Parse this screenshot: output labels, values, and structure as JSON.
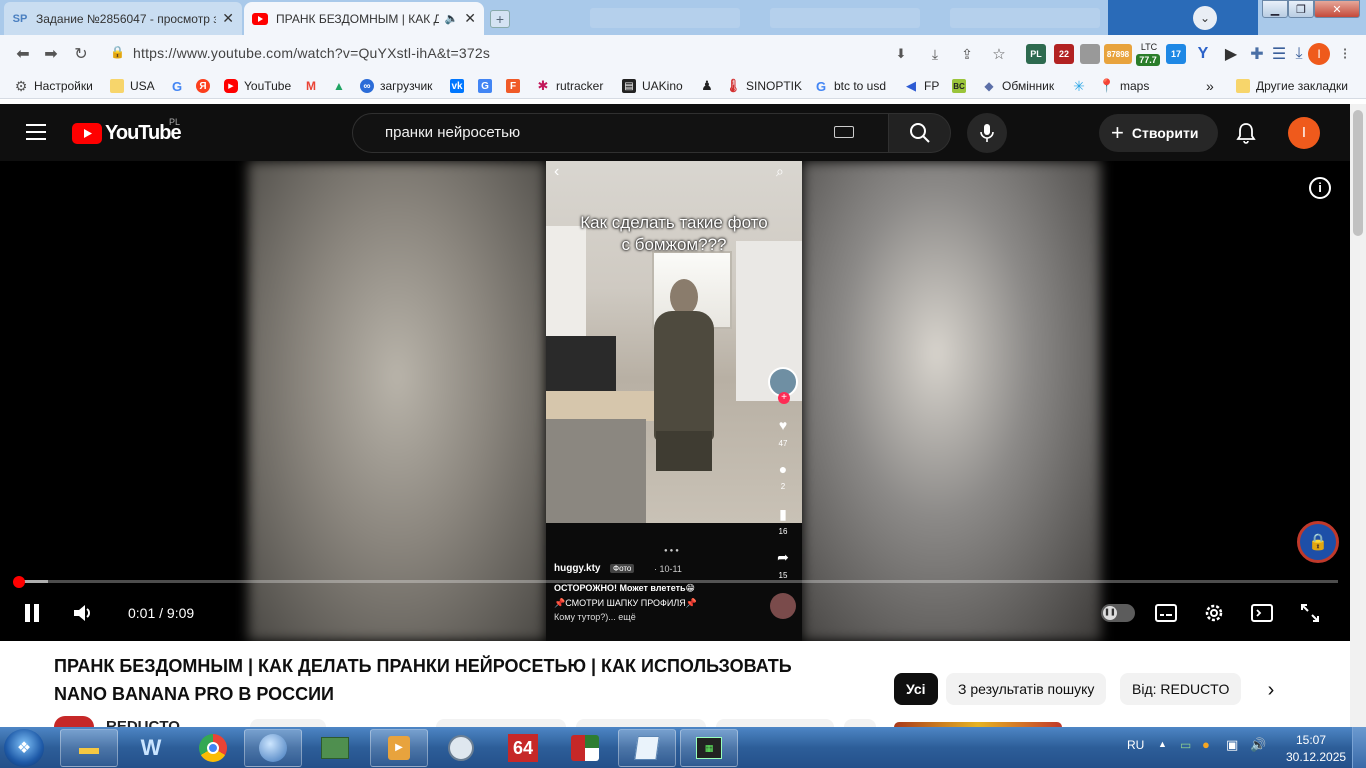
{
  "browser": {
    "tabs": [
      {
        "title": "Задание №2856047 - просмотр з",
        "favicon": "SP",
        "active": false
      },
      {
        "title": "ПРАНК БЕЗДОМНЫМ | КАК Д",
        "favicon": "youtube-icon",
        "active": true,
        "audio": true
      }
    ],
    "background_tabs_visible": true,
    "url": "https://www.youtube.com/watch?v=QuYXstl-ihA&t=372s",
    "extensions": [
      {
        "name": "eye-ext",
        "badge": "PL"
      },
      {
        "name": "red-ext",
        "badge": "22"
      },
      {
        "name": "price-ext",
        "badge": "87898"
      },
      {
        "name": "ltc-ext",
        "label": "LTC",
        "badge": "77.7"
      },
      {
        "name": "blue-ext",
        "badge": "17"
      }
    ],
    "bookmarks": [
      {
        "label": "Настройки",
        "icon": "gear-icon"
      },
      {
        "label": "USA",
        "icon": "folder-icon"
      },
      {
        "label": "",
        "icon": "google-icon"
      },
      {
        "label": "",
        "icon": "yandex-icon"
      },
      {
        "label": "YouTube",
        "icon": "youtube-icon"
      },
      {
        "label": "",
        "icon": "gmail-icon"
      },
      {
        "label": "",
        "icon": "drive-icon"
      },
      {
        "label": "загрузчик",
        "icon": "download-icon"
      },
      {
        "label": "",
        "icon": "vk-icon"
      },
      {
        "label": "",
        "icon": "translate-icon"
      },
      {
        "label": "",
        "icon": "f-icon"
      },
      {
        "label": "rutracker",
        "icon": "rutracker-icon"
      },
      {
        "label": "UAKino",
        "icon": "uakino-icon"
      },
      {
        "label": "",
        "icon": "pawn-icon"
      },
      {
        "label": "SINOPTIK",
        "icon": "thermometer-icon"
      },
      {
        "label": "btc to usd",
        "icon": "google-icon"
      },
      {
        "label": "FP",
        "icon": "fp-icon"
      },
      {
        "label": "",
        "icon": "bc-icon"
      },
      {
        "label": "Обмінник",
        "icon": "exchange-icon"
      },
      {
        "label": "",
        "icon": "star-icon"
      },
      {
        "label": "maps",
        "icon": "maps-icon"
      }
    ],
    "bookmarks_more": "»",
    "other_bookmarks": "Другие закладки"
  },
  "youtube": {
    "logo": "YouTube",
    "region": "PL",
    "search_value": "пранки нейросетью",
    "create_label": "Створити",
    "avatar_letter": "I",
    "player": {
      "current_time": "0:01",
      "separator": " / ",
      "duration": "9:09",
      "progress_fraction": 0.002,
      "buffered_fraction": 0.024
    },
    "phone_screen": {
      "caption_line1": "Как сделать такие фото",
      "caption_line2": "с бомжом???",
      "likes": "47",
      "comments": "2",
      "saves": "16",
      "shares": "15",
      "username": "huggy.kty",
      "tag": "Фото",
      "date": "· 10-11",
      "desc_line1": "ОСТОРОЖНО! Может влететь😁",
      "desc_line2": "📌СМОТРИ ШАПКУ ПРОФИЛЯ📌",
      "desc_line3": "Кому тутор?)... ещё"
    },
    "video_title_line1": "ПРАНК БЕЗДОМНЫМ | КАК ДЕЛАТЬ ПРАНКИ НЕЙРОСЕТЬЮ | КАК ИСПОЛЬЗОВАТЬ",
    "video_title_line2": "NANO BANANA PRO В РОССИИ",
    "channel_name": "REDUCTO",
    "chips": [
      "Усі",
      "З результатів пошуку",
      "Від: REDUCTO"
    ]
  },
  "taskbar": {
    "language": "RU",
    "time": "15:07",
    "date": "30.12.2025",
    "apps": [
      "explorer-icon",
      "defender-icon",
      "chrome-icon",
      "network-icon",
      "calculator-icon",
      "media-player-icon",
      "clock-icon",
      "aida64-icon",
      "chart-app-icon",
      "notepad-icon",
      "terminal-icon"
    ],
    "aida_label": "64"
  },
  "colors": {
    "yt_red": "#ff0000",
    "yt_dark": "#0f0f0f",
    "avatar_orange": "#ef5a1c",
    "tab_strip": "#a9c9ea"
  }
}
